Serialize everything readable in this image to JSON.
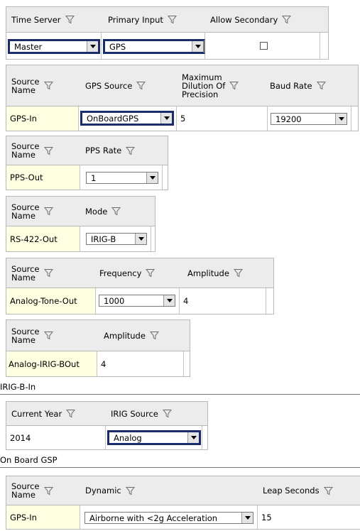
{
  "time_server_grid": {
    "headers": [
      "Time Server",
      "Primary Input",
      "Allow Secondary"
    ],
    "time_server": "Master",
    "primary_input": "GPS",
    "allow_secondary": false
  },
  "gps_grid": {
    "headers": [
      "Source\nName",
      "GPS Source",
      "Maximum\nDilution Of\nPrecision",
      "Baud Rate"
    ],
    "source_name": "GPS-In",
    "gps_source": "OnBoardGPS",
    "max_dop": "5",
    "baud_rate": "19200"
  },
  "pps_grid": {
    "headers": [
      "Source\nName",
      "PPS Rate"
    ],
    "source_name": "PPS-Out",
    "pps_rate": "1"
  },
  "rs422_grid": {
    "headers": [
      "Source\nName",
      "Mode"
    ],
    "source_name": "RS-422-Out",
    "mode": "IRIG-B"
  },
  "analog_tone_grid": {
    "headers": [
      "Source\nName",
      "Frequency",
      "Amplitude"
    ],
    "source_name": "Analog-Tone-Out",
    "frequency": "1000",
    "amplitude": "4"
  },
  "analog_irig_grid": {
    "headers": [
      "Source\nName",
      "Amplitude"
    ],
    "source_name": "Analog-IRIG-BOut",
    "amplitude": "4"
  },
  "irig_b_in": {
    "section_title": "IRIG-B-In",
    "headers": [
      "Current Year",
      "IRIG Source"
    ],
    "current_year": "2014",
    "irig_source": "Analog"
  },
  "onboard_gsp": {
    "section_title": "On Board GSP",
    "headers": [
      "Source\nName",
      "Dynamic",
      "Leap Seconds"
    ],
    "source_name": "GPS-In",
    "dynamic": "Airborne with <2g Acceleration",
    "leap_seconds": "15"
  }
}
